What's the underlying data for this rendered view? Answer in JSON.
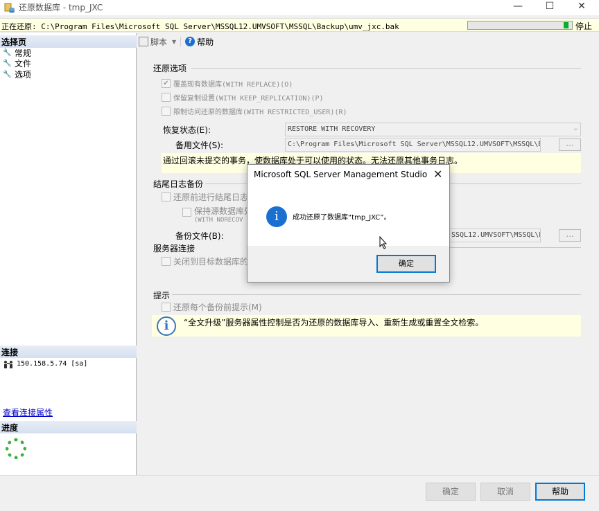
{
  "window": {
    "title": "还原数据库 - tmp_JXC",
    "minimize_glyph": "—",
    "maximize_glyph": "☐",
    "close_glyph": "✕"
  },
  "status": {
    "text": "正在还原: C:\\Program Files\\Microsoft SQL Server\\MSSQL12.UMVSOFT\\MSSQL\\Backup\\umv_jxc.bak",
    "progress_percent": 97,
    "stop_label": "停止"
  },
  "left": {
    "select_page_title": "选择页",
    "pages": [
      {
        "label": "常规",
        "icon": "wrench-icon"
      },
      {
        "label": "文件",
        "icon": "wrench-icon"
      },
      {
        "label": "选项",
        "icon": "wrench-icon"
      }
    ],
    "connection_title": "连接",
    "connection_value": "150.158.5.74 [sa]",
    "view_connection_link": "查看连接属性",
    "progress_title": "进度"
  },
  "toolbar": {
    "script_label": "脚本",
    "help_label": "帮助"
  },
  "restore_options": {
    "title": "还原选项",
    "opt_replace": "覆盖现有数据库(WITH REPLACE)(O)",
    "opt_keep_replication": "保留复制设置(WITH KEEP_REPLICATION)(P)",
    "opt_restricted_user": "限制访问还原的数据库(WITH RESTRICTED_USER)(R)",
    "recovery_state_label": "恢复状态(E):",
    "recovery_state_value": "RESTORE WITH RECOVERY",
    "standby_file_label": "备用文件(S):",
    "standby_file_value": "C:\\Program Files\\Microsoft SQL Server\\MSSQL12.UMVSOFT\\MSSQL\\B",
    "recovery_note": "通过回滚未提交的事务，使数据库处于可以使用的状态。无法还原其他事务日志。"
  },
  "tail_log": {
    "title": "结尾日志备份",
    "opt_tail_log": "还原前进行结尾日志",
    "opt_norecovery_line1": "保持源数据库处",
    "opt_norecovery_line2": "(WITH NORECOV",
    "backup_file_label": "备份文件(B):",
    "backup_file_value": "SSQL12.UMVSOFT\\MSSQL\\B"
  },
  "server_conn": {
    "title": "服务器连接",
    "opt_close": "关闭到目标数据库的"
  },
  "prompt": {
    "title": "提示",
    "opt_prompt": "还原每个备份前提示(M)",
    "info_text": "“全文升级”服务器属性控制是否为还原的数据库导入、重新生成或重置全文检索。"
  },
  "dialog": {
    "title": "Microsoft SQL Server Management Studio",
    "message": "成功还原了数据库“tmp_JXC”。",
    "ok_label": "确定"
  },
  "footer": {
    "ok_label": "确定",
    "cancel_label": "取消",
    "help_label": "帮助"
  },
  "colors": {
    "accent": "#0078d7",
    "progress_green": "#06b025",
    "info_blue": "#1a6fd1",
    "note_bg": "#ffffe1"
  }
}
